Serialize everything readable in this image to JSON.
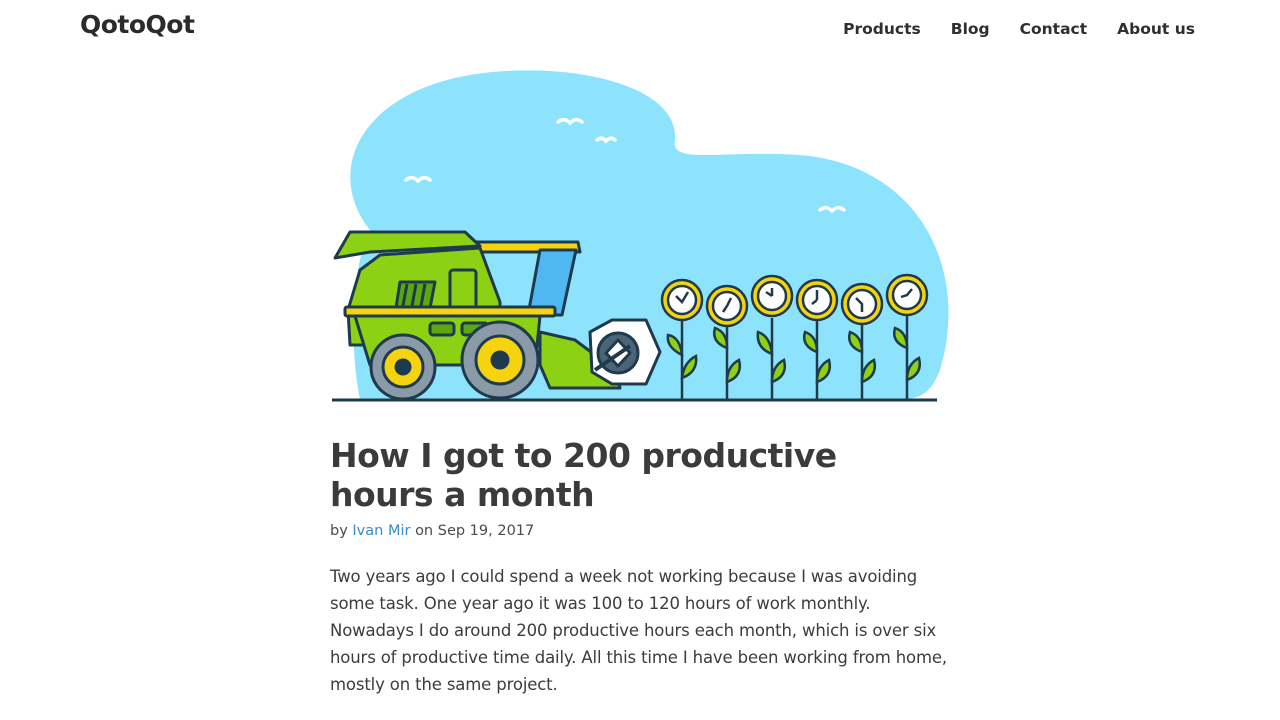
{
  "header": {
    "logo_text": "QotoQot",
    "nav": [
      {
        "label": "Products"
      },
      {
        "label": "Blog"
      },
      {
        "label": "Contact"
      },
      {
        "label": "About us"
      }
    ]
  },
  "hero": {
    "icon": "harvester-illustration",
    "colors": {
      "sky": "#8ee3fc",
      "harvester": "#8dd114",
      "outline": "#1f3a4d",
      "wheel": "#f5d40f"
    }
  },
  "article": {
    "title": "How I got to 200 productive hours a month",
    "byline_prefix": "by",
    "author": "Ivan Mir",
    "date_prefix": "on",
    "date": "Sep 19, 2017",
    "intro": "Two years ago I could spend a week not working because I was avoiding some task. One year ago it was 100 to 120 hours of work monthly. Nowadays I do around 200 productive hours each month, which is over six hours of productive time daily. All this time I have been working from home, mostly on the same project."
  }
}
